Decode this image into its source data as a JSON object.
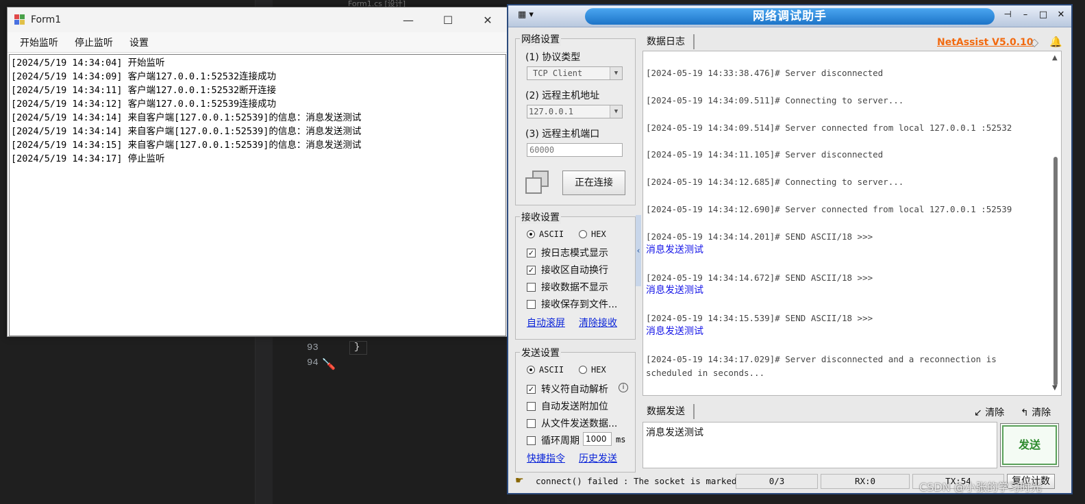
{
  "ide": {
    "tab_text": "Form1.cs [设计]",
    "line_numbers": [
      "93",
      "94"
    ],
    "brace": "}"
  },
  "form1": {
    "title": "Form1",
    "window_buttons": {
      "minimize": "—",
      "maximize": "☐",
      "close": "✕"
    },
    "menu": [
      "开始监听",
      "停止监听",
      "设置"
    ],
    "log_lines": [
      "[2024/5/19 14:34:04] 开始监听",
      "[2024/5/19 14:34:09] 客户端127.0.0.1:52532连接成功",
      "[2024/5/19 14:34:11] 客户端127.0.0.1:52532断开连接",
      "[2024/5/19 14:34:12] 客户端127.0.0.1:52539连接成功",
      "[2024/5/19 14:34:14] 来自客户端[127.0.0.1:52539]的信息：消息发送测试",
      "[2024/5/19 14:34:14] 来自客户端[127.0.0.1:52539]的信息：消息发送测试",
      "[2024/5/19 14:34:15] 来自客户端[127.0.0.1:52539]的信息：消息发送测试",
      "[2024/5/19 14:34:17] 停止监听"
    ]
  },
  "netassist": {
    "title": "网络调试助手",
    "version": "NetAssist V5.0.10",
    "title_buttons": {
      "pin": "⊣",
      "minimize": "–",
      "maximize": "□",
      "close": "✕"
    },
    "network": {
      "group_title": "网络设置",
      "protocol_label": "(1) 协议类型",
      "protocol_value": "TCP Client",
      "host_label": "(2) 远程主机地址",
      "host_value": "127.0.0.1",
      "port_label": "(3) 远程主机端口",
      "port_value": "60000",
      "connect_button": "正在连接"
    },
    "receive": {
      "group_title": "接收设置",
      "radio_ascii": "ASCII",
      "radio_hex": "HEX",
      "options": [
        {
          "label": "按日志模式显示",
          "checked": true
        },
        {
          "label": "接收区自动换行",
          "checked": true
        },
        {
          "label": "接收数据不显示",
          "checked": false
        },
        {
          "label": "接收保存到文件...",
          "checked": false
        }
      ],
      "link_autoscroll": "自动滚屏",
      "link_clear": "清除接收"
    },
    "send": {
      "group_title": "发送设置",
      "radio_ascii": "ASCII",
      "radio_hex": "HEX",
      "options": [
        {
          "label": "转义符自动解析",
          "checked": true
        },
        {
          "label": "自动发送附加位",
          "checked": false
        },
        {
          "label": "从文件发送数据...",
          "checked": false
        },
        {
          "label": "循环周期",
          "checked": false
        }
      ],
      "cycle_value": "1000",
      "cycle_unit": "ms",
      "link_shortcut": "快捷指令",
      "link_history": "历史发送"
    },
    "log_tab": "数据日志",
    "log_entries": [
      {
        "head": "[2024-05-19 14:33:38.476]# Server disconnected",
        "msg": ""
      },
      {
        "head": "[2024-05-19 14:34:09.511]# Connecting to server...",
        "msg": ""
      },
      {
        "head": "[2024-05-19 14:34:09.514]# Server connected from local 127.0.0.1 :52532",
        "msg": ""
      },
      {
        "head": "[2024-05-19 14:34:11.105]# Server disconnected",
        "msg": ""
      },
      {
        "head": "[2024-05-19 14:34:12.685]# Connecting to server...",
        "msg": ""
      },
      {
        "head": "[2024-05-19 14:34:12.690]# Server connected from local 127.0.0.1 :52539",
        "msg": ""
      },
      {
        "head": "[2024-05-19 14:34:14.201]# SEND ASCII/18 >>>",
        "msg": "消息发送测试"
      },
      {
        "head": "[2024-05-19 14:34:14.672]# SEND ASCII/18 >>>",
        "msg": "消息发送测试"
      },
      {
        "head": "[2024-05-19 14:34:15.539]# SEND ASCII/18 >>>",
        "msg": "消息发送测试"
      },
      {
        "head": "[2024-05-19 14:34:17.029]# Server disconnected and a reconnection is scheduled in seconds...",
        "msg": ""
      }
    ],
    "send_tab": "数据发送",
    "clear_recv": "清除",
    "clear_send": "清除",
    "send_text": "消息发送测试",
    "send_button": "发送",
    "status": {
      "message": "connect() failed : The socket is marked",
      "count": "0/3",
      "rx": "RX:0",
      "tx": "TX:54",
      "reset": "复位计数"
    }
  },
  "watermark": "CSDN @小张的学习时光",
  "colors": {
    "accent": "#1d74c8",
    "version": "#f26a10",
    "link": "#0a24d8",
    "send_green": "#2e8b2e"
  }
}
